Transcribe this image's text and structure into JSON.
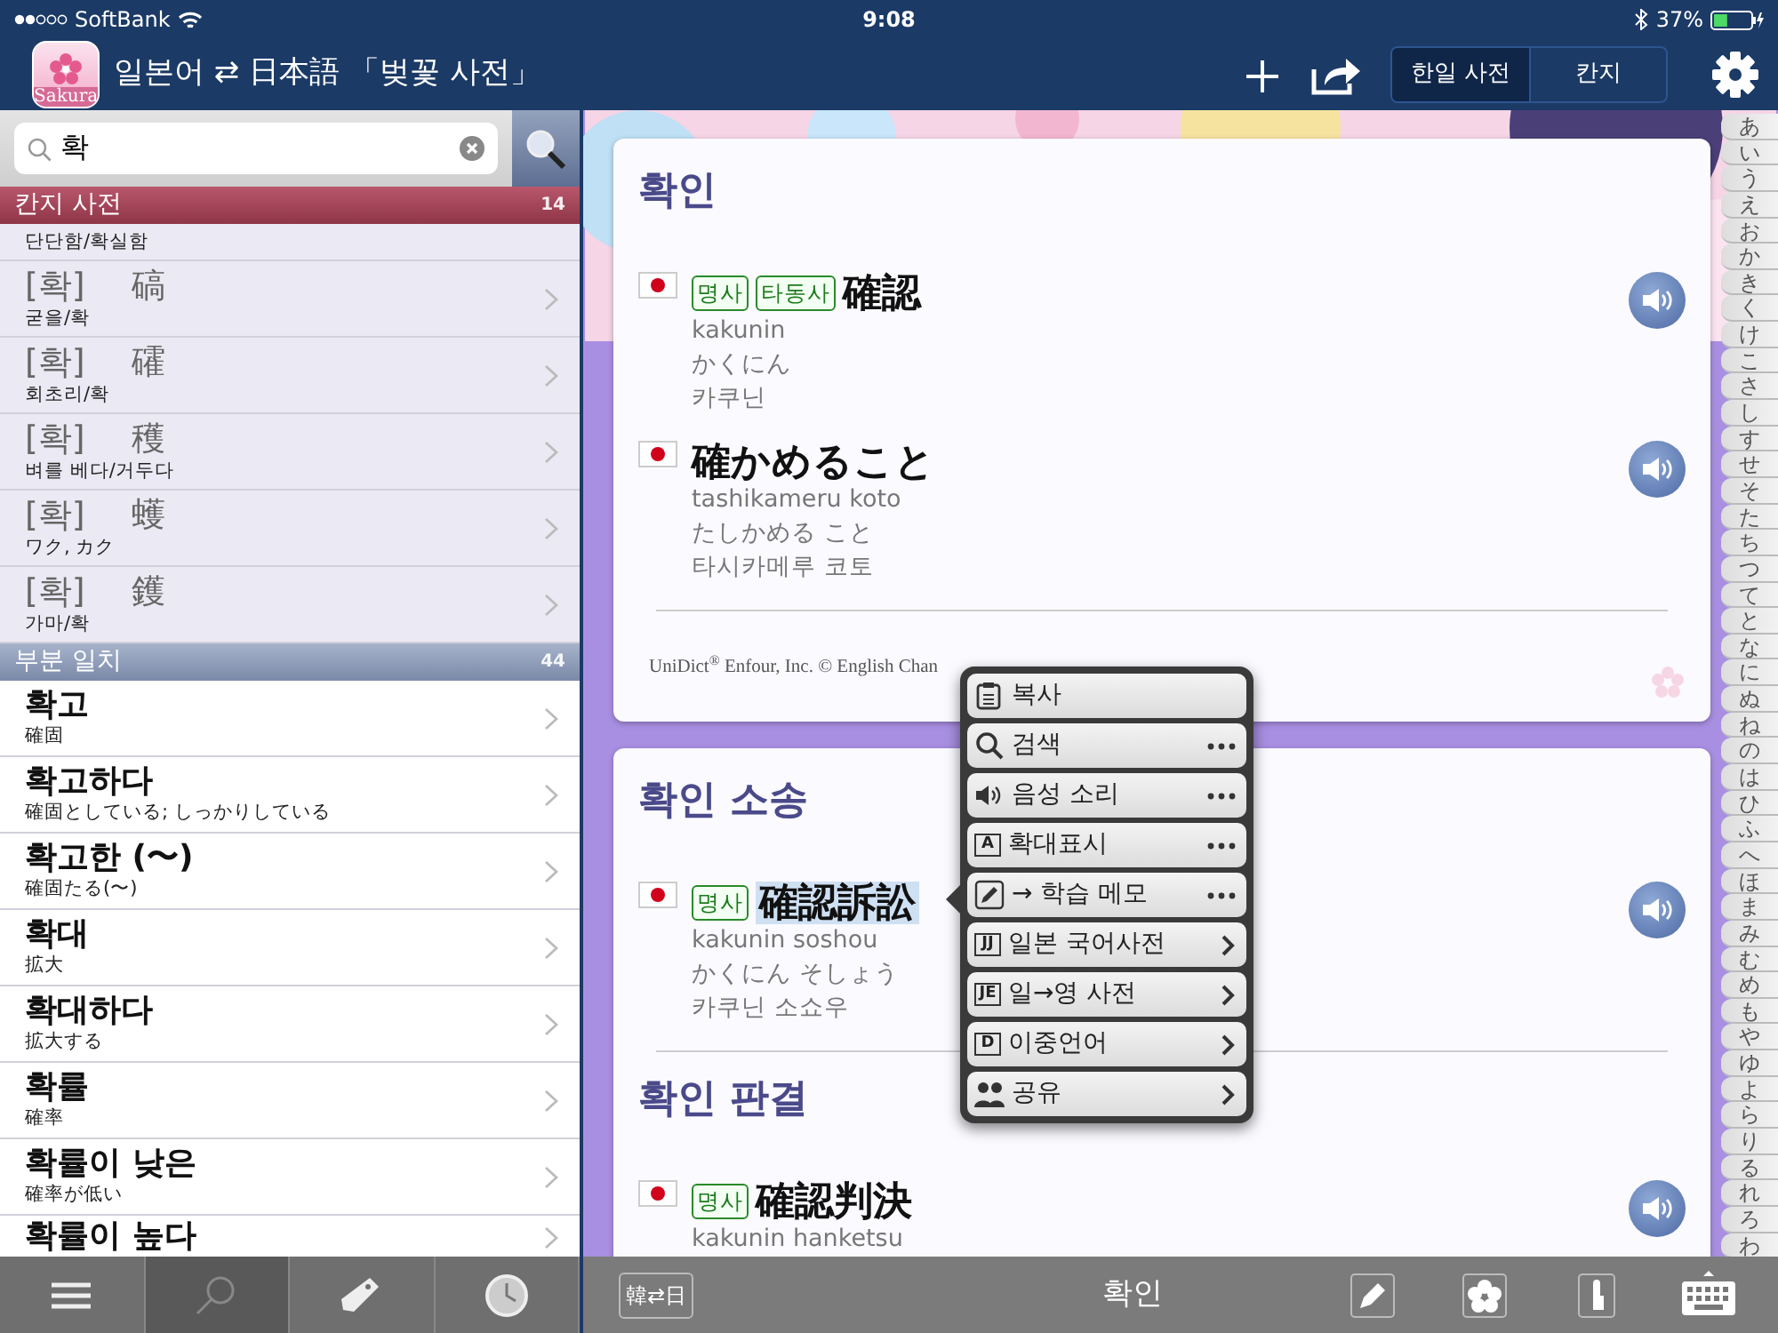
{
  "status_bar": {
    "carrier": "SoftBank",
    "time": "9:08",
    "battery": "37%"
  },
  "nav": {
    "app_icon_label": "Sakura",
    "title": "일본어 ⇄ 日本語 「벚꽃 사전」",
    "segments": [
      {
        "label": "한일 사전",
        "selected": true
      },
      {
        "label": "칸지",
        "selected": false
      }
    ]
  },
  "search": {
    "value": "확"
  },
  "sections": [
    {
      "kind": "kanji",
      "title": "칸지 사전",
      "count": "14",
      "items": [
        {
          "meaning": "단단함/확실함"
        },
        {
          "reading": "[확]",
          "kanji": "碻",
          "meaning": "굳을/확"
        },
        {
          "reading": "[확]",
          "kanji": "礭",
          "meaning": "회초리/확"
        },
        {
          "reading": "[확]",
          "kanji": "穫",
          "meaning": "벼를 베다/거두다"
        },
        {
          "reading": "[확]",
          "kanji": "蠖",
          "meaning": "ワク, カク"
        },
        {
          "reading": "[확]",
          "kanji": "鑊",
          "meaning": "가마/확"
        }
      ]
    },
    {
      "kind": "word",
      "title": "부분 일치",
      "count": "44",
      "items": [
        {
          "word": "확고",
          "meaning": "確固"
        },
        {
          "word": "확고하다",
          "meaning": "確固としている; しっかりしている"
        },
        {
          "word": "확고한 (〜)",
          "meaning": "確固たる(〜)"
        },
        {
          "word": "확대",
          "meaning": "拡大"
        },
        {
          "word": "확대하다",
          "meaning": "拡大する"
        },
        {
          "word": "확률",
          "meaning": "確率"
        },
        {
          "word": "확률이 낮은",
          "meaning": "確率が低い"
        },
        {
          "word": "확률이 높다"
        }
      ]
    }
  ],
  "tabbar": [
    {
      "kind": "list",
      "selected": false
    },
    {
      "kind": "search",
      "selected": true
    },
    {
      "kind": "tag",
      "selected": false
    },
    {
      "kind": "clock",
      "selected": false
    }
  ],
  "cards": [
    {
      "entries": [
        {
          "title": "확인",
          "senses": [
            {
              "tags": [
                "명사",
                "타동사"
              ],
              "headword": "確認",
              "selected": false,
              "romaji": "kakunin",
              "kana": "かくにん",
              "hangul": "카쿠닌"
            },
            {
              "headword": "確かめること",
              "selected": false,
              "romaji": "tashikameru koto",
              "kana": "たしかめる こと",
              "hangul": "타시카메루 코토"
            }
          ]
        }
      ],
      "copyright": "UniDict$^{®}$ Enfour, Inc. © English Chan"
    },
    {
      "entries": [
        {
          "title": "확인 소송",
          "senses": [
            {
              "tags": [
                "명사"
              ],
              "headword": "確認訴訟",
              "selected": true,
              "romaji": "kakunin soshou",
              "kana": "かくにん そしょう",
              "hangul": "카쿠닌 소쇼우"
            }
          ]
        },
        {
          "title": "확인 판결",
          "senses": [
            {
              "tags": [
                "명사"
              ],
              "headword": "確認判決",
              "selected": false,
              "romaji": "kakunin hanketsu"
            }
          ]
        }
      ]
    }
  ],
  "popup": [
    {
      "kind": "copy",
      "label": "복사",
      "more": false,
      "submenu": false
    },
    {
      "kind": "search",
      "label": "검색",
      "more": true,
      "submenu": false
    },
    {
      "kind": "sound",
      "label": "음성 소리",
      "more": true,
      "submenu": false
    },
    {
      "kind": "letter",
      "icon_text": "A",
      "label": "확대표시",
      "more": true,
      "submenu": false
    },
    {
      "kind": "memo",
      "label": "→ 학습 메모",
      "more": true,
      "submenu": false
    },
    {
      "kind": "book",
      "icon_text": "JJ",
      "label": "일본 국어사전",
      "more": false,
      "submenu": true
    },
    {
      "kind": "book",
      "icon_text": "JE",
      "label": "일→영 사전",
      "more": false,
      "submenu": true
    },
    {
      "kind": "book",
      "icon_text": "D",
      "label": "이중언어",
      "more": false,
      "submenu": true
    },
    {
      "kind": "share",
      "label": "공유",
      "more": false,
      "submenu": true
    }
  ],
  "toolbar": {
    "toggle": "韓⇄日",
    "query": "확인",
    "tools": [
      {
        "kind": "pencil"
      },
      {
        "kind": "flower"
      },
      {
        "kind": "finger"
      },
      {
        "kind": "keyboard"
      }
    ]
  },
  "kana_index": [
    "あ",
    "い",
    "う",
    "え",
    "お",
    "か",
    "き",
    "く",
    "け",
    "こ",
    "さ",
    "し",
    "す",
    "せ",
    "そ",
    "た",
    "ち",
    "つ",
    "て",
    "と",
    "な",
    "に",
    "ぬ",
    "ね",
    "の",
    "は",
    "ひ",
    "ふ",
    "へ",
    "ほ",
    "ま",
    "み",
    "む",
    "め",
    "も",
    "や",
    "ゆ",
    "よ",
    "ら",
    "り",
    "る",
    "れ",
    "ろ",
    "わ"
  ]
}
